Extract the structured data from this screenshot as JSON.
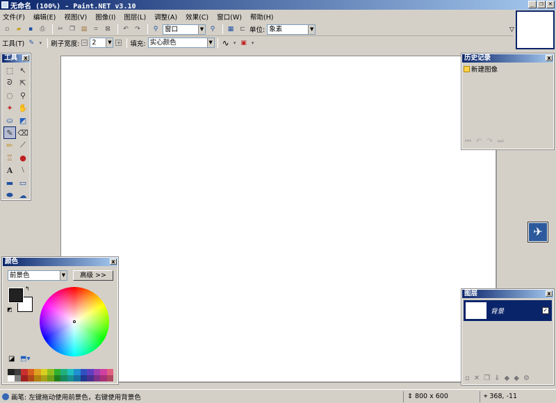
{
  "window": {
    "title": "无命名 (100%) - Paint.NET v3.10",
    "buttons": [
      "_",
      "❐",
      "✕"
    ]
  },
  "menu": [
    "文件(F)",
    "编辑(E)",
    "视图(V)",
    "图像(I)",
    "图层(L)",
    "调整(A)",
    "效果(C)",
    "窗口(W)",
    "帮助(H)"
  ],
  "toolbar1": {
    "zoom_value": "窗口",
    "unit_label": "单位:",
    "unit_value": "象素"
  },
  "toolbar2": {
    "tool_label": "工具(T)",
    "brush_label": "刷子宽度:",
    "brush_value": "2",
    "fill_label": "填充:",
    "fill_value": "实心颜色"
  },
  "tools_panel": {
    "title": "工具",
    "close": "x"
  },
  "history_panel": {
    "title": "历史记录",
    "close": "x",
    "items": [
      "新建图像"
    ]
  },
  "colors_panel": {
    "title": "颜色",
    "close": "x",
    "selector_value": "前景色",
    "advanced_label": "高级 >>"
  },
  "layers_panel": {
    "title": "图层",
    "close": "x",
    "layer_name": "背景",
    "checked": "✓"
  },
  "status": {
    "message": "画笔: 左键拖动使用前景色，右键使用背景色",
    "size": "800 x 600",
    "position": "368, -11"
  },
  "palette_colors": [
    "#222222",
    "#404040",
    "#c83030",
    "#d86020",
    "#e0a020",
    "#d8d020",
    "#90c020",
    "#30b030",
    "#20b080",
    "#20c0c0",
    "#2090d0",
    "#3050c0",
    "#6040c0",
    "#a040b0",
    "#d040a0",
    "#e06080",
    "#ffffff",
    "#808080",
    "#a02020",
    "#b04818",
    "#b08010",
    "#a8a018",
    "#70a018",
    "#208020",
    "#188860",
    "#189090",
    "#1870a0",
    "#203890",
    "#483090",
    "#803088",
    "#a83078",
    "#b04860"
  ]
}
